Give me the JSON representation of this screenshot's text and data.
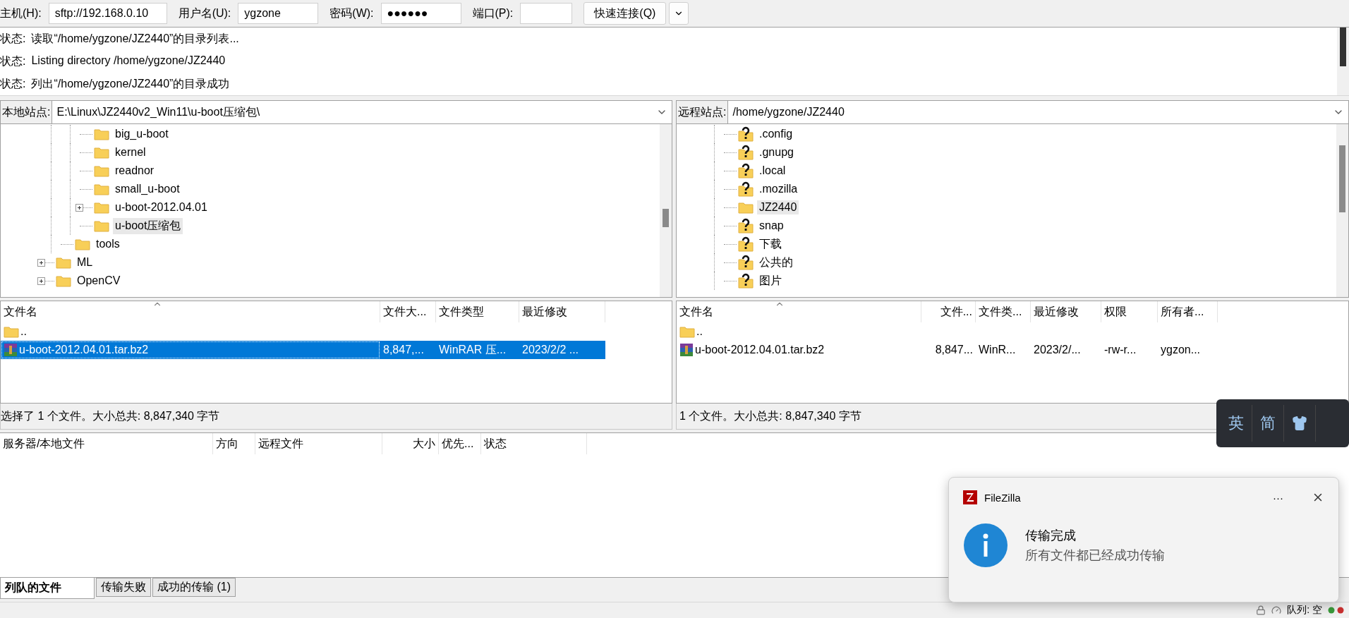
{
  "toolbar": {
    "fields": [
      {
        "label": "主机(H):",
        "value": "sftp://192.168.0.10"
      },
      {
        "label": "用户名(U):",
        "value": "ygzone"
      },
      {
        "label": "密码(W):",
        "value": "●●●●●●"
      },
      {
        "label": "端口(P):"
      }
    ],
    "connect_button": "快速连接(Q)"
  },
  "log": [
    {
      "prefix": "状态:",
      "message": "读取“/home/ygzone/JZ2440”的目录列表..."
    },
    {
      "prefix": "状态:",
      "message": "Listing directory /home/ygzone/JZ2440"
    },
    {
      "prefix": "状态:",
      "message": "列出“/home/ygzone/JZ2440”的目录成功"
    }
  ],
  "local": {
    "label": "本地站点:",
    "path": "E:\\Linux\\JZ2440v2_Win11\\u-boot压缩包\\",
    "tree": [
      {
        "children": [
          {
            "children": [
              {
                "label": "big_u-boot",
                "kind": "folder",
                "expandable": false,
                "selected": false
              },
              {
                "label": "kernel",
                "kind": "folder",
                "expandable": false,
                "selected": false
              },
              {
                "label": "readnor",
                "kind": "folder",
                "expandable": false,
                "selected": false
              },
              {
                "label": "small_u-boot",
                "kind": "folder",
                "expandable": false,
                "selected": false
              },
              {
                "label": "u-boot-2012.04.01",
                "kind": "folder",
                "expandable": true,
                "selected": false
              },
              {
                "label": "u-boot压缩包",
                "kind": "folder",
                "expandable": false,
                "selected": true
              }
            ]
          },
          {
            "label": "tools",
            "kind": "folder",
            "expandable": false,
            "selected": false
          }
        ]
      },
      {
        "label": "ML",
        "kind": "folder",
        "expandable": true,
        "selected": false
      },
      {
        "label": "OpenCV",
        "kind": "folder",
        "expandable": true,
        "selected": false
      }
    ],
    "columns": [
      "文件名",
      "文件大...",
      "文件类型",
      "最近修改"
    ],
    "rows": [
      {
        "kind": "folder",
        "name": "..",
        "selected": false
      },
      {
        "kind": "archive",
        "name": "u-boot-2012.04.01.tar.bz2",
        "details": [
          "8,847,...",
          "WinRAR 压...",
          "2023/2/2 ..."
        ],
        "selected": true
      }
    ],
    "status": "选择了 1 个文件。大小总共: 8,847,340 字节"
  },
  "remote": {
    "label": "远程站点:",
    "path": "/home/ygzone/JZ2440",
    "tree": [
      {
        "children": [
          {
            "label": ".config",
            "kind": "unknown",
            "expandable": false,
            "selected": false
          },
          {
            "label": ".gnupg",
            "kind": "unknown",
            "expandable": false,
            "selected": false
          },
          {
            "label": ".local",
            "kind": "unknown",
            "expandable": false,
            "selected": false
          },
          {
            "label": ".mozilla",
            "kind": "unknown",
            "expandable": false,
            "selected": false
          },
          {
            "label": "JZ2440",
            "kind": "folder",
            "expandable": false,
            "selected": true
          },
          {
            "label": "snap",
            "kind": "unknown",
            "expandable": false,
            "selected": false
          },
          {
            "label": "下载",
            "kind": "unknown",
            "expandable": false,
            "selected": false
          },
          {
            "label": "公共的",
            "kind": "unknown",
            "expandable": false,
            "selected": false
          },
          {
            "label": "图片",
            "kind": "unknown",
            "expandable": false,
            "selected": false
          }
        ]
      }
    ],
    "columns": [
      "文件名",
      "文件...",
      "文件类...",
      "最近修改",
      "权限",
      "所有者..."
    ],
    "rows": [
      {
        "kind": "folder",
        "name": "..",
        "selected": false
      },
      {
        "kind": "archive",
        "name": "u-boot-2012.04.01.tar.bz2",
        "details": [
          "8,847...",
          "WinR...",
          "2023/2/...",
          "-rw-r...",
          "ygzon..."
        ],
        "selected": false
      }
    ],
    "status": "1 个文件。大小总共: 8,847,340 字节"
  },
  "queue": {
    "columns": [
      "服务器/本地文件",
      "方向",
      "远程文件",
      "大小",
      "优先...",
      "状态"
    ]
  },
  "tabs": [
    {
      "label": "列队的文件",
      "selected": true
    },
    {
      "label": "传输失败",
      "selected": false
    },
    {
      "label": "成功的传输 (1)",
      "selected": false
    }
  ],
  "status_bar": {
    "queue": "队列: 空"
  },
  "ime": {
    "items": [
      "英",
      "简"
    ]
  },
  "notification": {
    "app": "FileZilla",
    "more": "···",
    "title": "传输完成",
    "message": "所有文件都已经成功传输"
  }
}
